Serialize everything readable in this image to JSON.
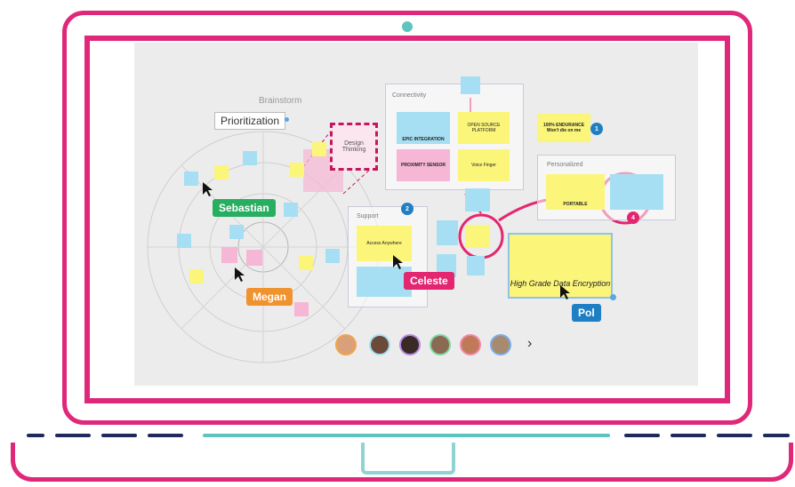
{
  "board": {
    "brainstorm_title": "Brainstorm",
    "prioritization_label": "Prioritization",
    "design_thinking_label": "Design Thinking",
    "connectivity_title": "Connectivity",
    "support_title": "Support",
    "personalized_title": "Personalized",
    "sketch_labels": {
      "epic_integration": "EPIC INTEGRATION",
      "open_source": "OPEN SOURCE PLATFORM",
      "proximity_sensor": "PROXIMITY SENSOR",
      "voice": "Voice",
      "finger": "Finger",
      "endurance": "100% ENDURANCE",
      "endurance_sub": "Won't die on me",
      "portable": "PORTABLE",
      "access_anywhere": "Access Anywhere",
      "high_grade": "High Grade Data Encryption"
    },
    "badges": [
      "1",
      "2",
      "4"
    ]
  },
  "collaborators": {
    "sebastian": "Sebastian",
    "megan": "Megan",
    "celeste": "Celeste",
    "pol": "Pol"
  },
  "colors": {
    "laptop": "#e0287a",
    "sebastian": "#27ae60",
    "megan": "#f0922e",
    "celeste": "#e3266f",
    "pol": "#1e7fc4",
    "teal": "#5ec4c0",
    "navy": "#1f2a5c"
  },
  "avatars_next": "›"
}
